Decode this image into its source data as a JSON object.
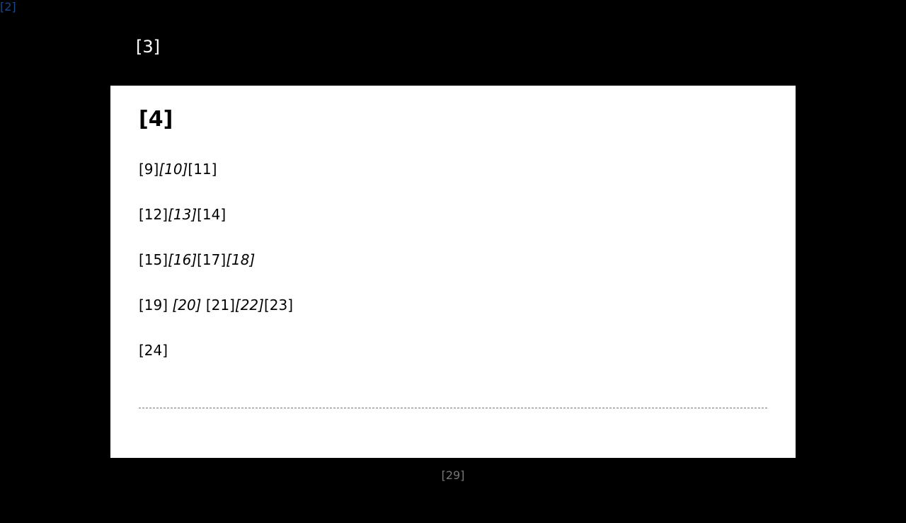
{
  "skip_link": "[2]",
  "header": {
    "title": "[3]"
  },
  "card": {
    "title": "[4]",
    "paragraphs": [
      {
        "parts": [
          "[9]",
          "[10]",
          "[11]"
        ]
      },
      {
        "parts": [
          "[12]",
          "[13]",
          "[14]"
        ]
      },
      {
        "parts": [
          "[15]",
          "[16]",
          "[17]",
          "[18]"
        ]
      },
      {
        "parts": [
          "[19]",
          "[20]",
          "[21]",
          "[22]",
          "[23]"
        ]
      },
      {
        "parts": [
          "[24]"
        ]
      }
    ]
  },
  "footer": {
    "text": "[29]"
  },
  "colors": {
    "background": "#000000",
    "card": "#ffffff",
    "link": "#1a4a8a",
    "muted": "#777777"
  }
}
